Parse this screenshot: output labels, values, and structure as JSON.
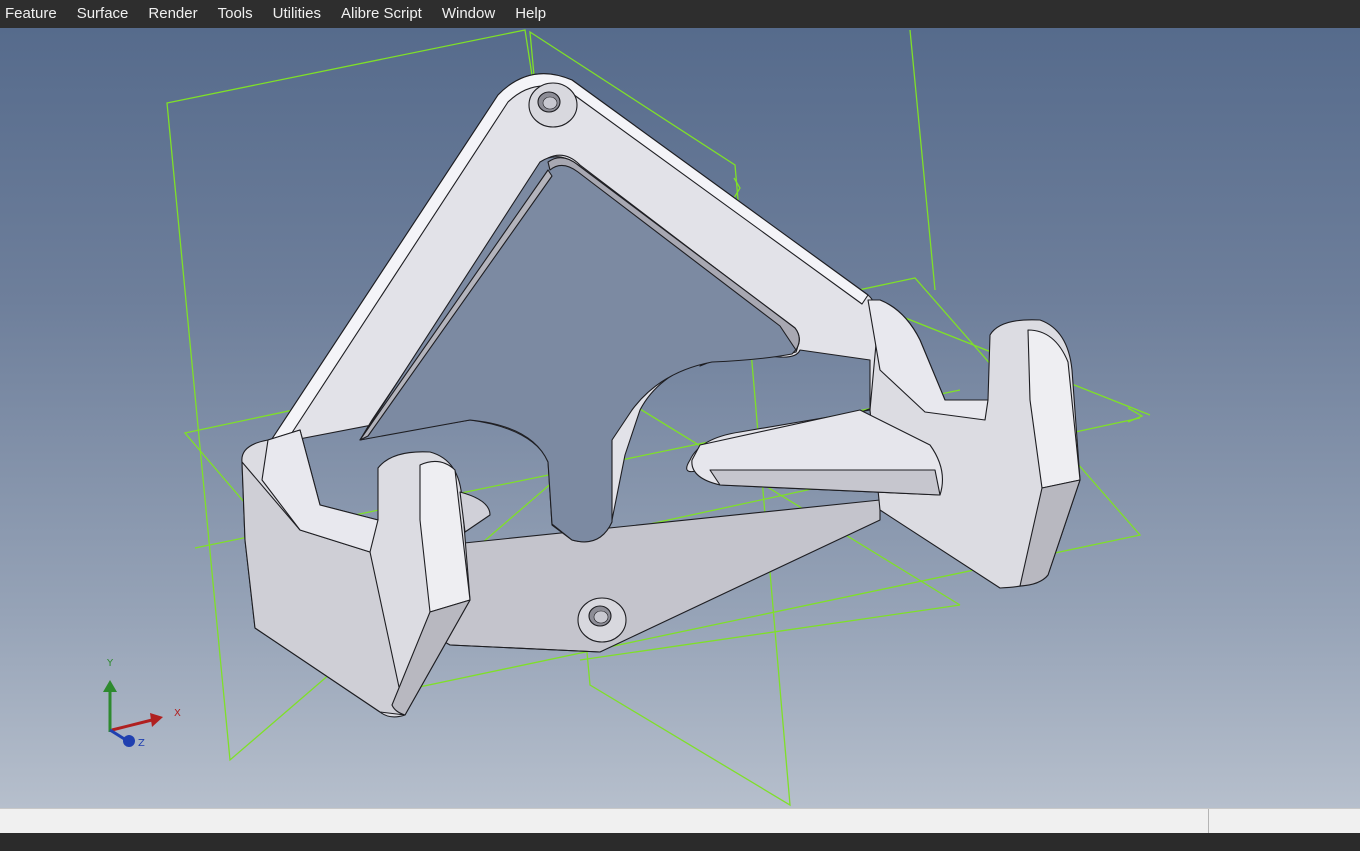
{
  "menubar": {
    "items": [
      "Feature",
      "Surface",
      "Render",
      "Tools",
      "Utilities",
      "Alibre Script",
      "Window",
      "Help"
    ]
  },
  "viewport": {
    "triad": {
      "x_label": "X",
      "y_label": "Y",
      "z_label": "Z"
    },
    "colors": {
      "sketch_lines": "#7fe028",
      "part_face": "#e2e2e8",
      "part_shade": "#c9c9d1",
      "edges": "#1e1e22",
      "axis_x": "#b02020",
      "axis_y": "#2e8a2e",
      "axis_z": "#2040b0"
    }
  },
  "statusbar": {
    "left_text": "",
    "right_text": ""
  }
}
